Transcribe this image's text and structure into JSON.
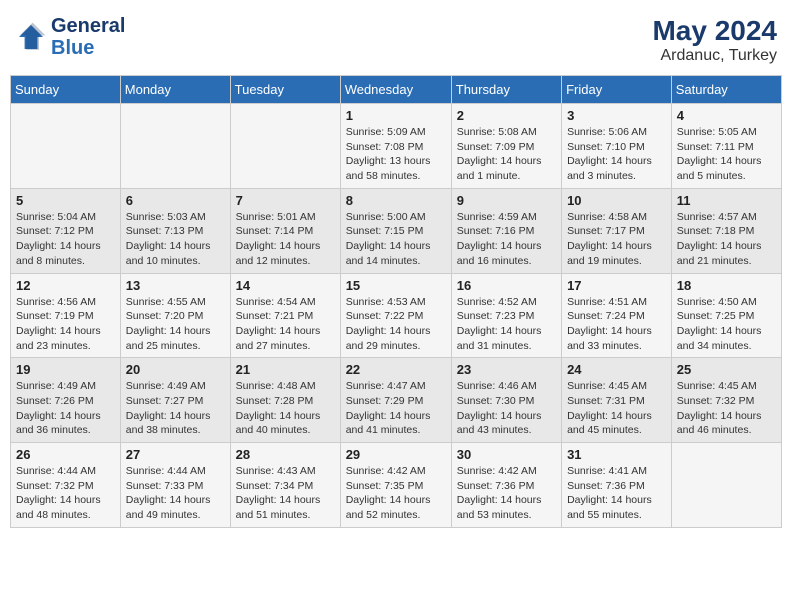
{
  "header": {
    "logo_line1": "General",
    "logo_line2": "Blue",
    "month": "May 2024",
    "location": "Ardanuc, Turkey"
  },
  "weekdays": [
    "Sunday",
    "Monday",
    "Tuesday",
    "Wednesday",
    "Thursday",
    "Friday",
    "Saturday"
  ],
  "weeks": [
    [
      {
        "day": "",
        "detail": ""
      },
      {
        "day": "",
        "detail": ""
      },
      {
        "day": "",
        "detail": ""
      },
      {
        "day": "1",
        "detail": "Sunrise: 5:09 AM\nSunset: 7:08 PM\nDaylight: 13 hours and 58 minutes."
      },
      {
        "day": "2",
        "detail": "Sunrise: 5:08 AM\nSunset: 7:09 PM\nDaylight: 14 hours and 1 minute."
      },
      {
        "day": "3",
        "detail": "Sunrise: 5:06 AM\nSunset: 7:10 PM\nDaylight: 14 hours and 3 minutes."
      },
      {
        "day": "4",
        "detail": "Sunrise: 5:05 AM\nSunset: 7:11 PM\nDaylight: 14 hours and 5 minutes."
      }
    ],
    [
      {
        "day": "5",
        "detail": "Sunrise: 5:04 AM\nSunset: 7:12 PM\nDaylight: 14 hours and 8 minutes."
      },
      {
        "day": "6",
        "detail": "Sunrise: 5:03 AM\nSunset: 7:13 PM\nDaylight: 14 hours and 10 minutes."
      },
      {
        "day": "7",
        "detail": "Sunrise: 5:01 AM\nSunset: 7:14 PM\nDaylight: 14 hours and 12 minutes."
      },
      {
        "day": "8",
        "detail": "Sunrise: 5:00 AM\nSunset: 7:15 PM\nDaylight: 14 hours and 14 minutes."
      },
      {
        "day": "9",
        "detail": "Sunrise: 4:59 AM\nSunset: 7:16 PM\nDaylight: 14 hours and 16 minutes."
      },
      {
        "day": "10",
        "detail": "Sunrise: 4:58 AM\nSunset: 7:17 PM\nDaylight: 14 hours and 19 minutes."
      },
      {
        "day": "11",
        "detail": "Sunrise: 4:57 AM\nSunset: 7:18 PM\nDaylight: 14 hours and 21 minutes."
      }
    ],
    [
      {
        "day": "12",
        "detail": "Sunrise: 4:56 AM\nSunset: 7:19 PM\nDaylight: 14 hours and 23 minutes."
      },
      {
        "day": "13",
        "detail": "Sunrise: 4:55 AM\nSunset: 7:20 PM\nDaylight: 14 hours and 25 minutes."
      },
      {
        "day": "14",
        "detail": "Sunrise: 4:54 AM\nSunset: 7:21 PM\nDaylight: 14 hours and 27 minutes."
      },
      {
        "day": "15",
        "detail": "Sunrise: 4:53 AM\nSunset: 7:22 PM\nDaylight: 14 hours and 29 minutes."
      },
      {
        "day": "16",
        "detail": "Sunrise: 4:52 AM\nSunset: 7:23 PM\nDaylight: 14 hours and 31 minutes."
      },
      {
        "day": "17",
        "detail": "Sunrise: 4:51 AM\nSunset: 7:24 PM\nDaylight: 14 hours and 33 minutes."
      },
      {
        "day": "18",
        "detail": "Sunrise: 4:50 AM\nSunset: 7:25 PM\nDaylight: 14 hours and 34 minutes."
      }
    ],
    [
      {
        "day": "19",
        "detail": "Sunrise: 4:49 AM\nSunset: 7:26 PM\nDaylight: 14 hours and 36 minutes."
      },
      {
        "day": "20",
        "detail": "Sunrise: 4:49 AM\nSunset: 7:27 PM\nDaylight: 14 hours and 38 minutes."
      },
      {
        "day": "21",
        "detail": "Sunrise: 4:48 AM\nSunset: 7:28 PM\nDaylight: 14 hours and 40 minutes."
      },
      {
        "day": "22",
        "detail": "Sunrise: 4:47 AM\nSunset: 7:29 PM\nDaylight: 14 hours and 41 minutes."
      },
      {
        "day": "23",
        "detail": "Sunrise: 4:46 AM\nSunset: 7:30 PM\nDaylight: 14 hours and 43 minutes."
      },
      {
        "day": "24",
        "detail": "Sunrise: 4:45 AM\nSunset: 7:31 PM\nDaylight: 14 hours and 45 minutes."
      },
      {
        "day": "25",
        "detail": "Sunrise: 4:45 AM\nSunset: 7:32 PM\nDaylight: 14 hours and 46 minutes."
      }
    ],
    [
      {
        "day": "26",
        "detail": "Sunrise: 4:44 AM\nSunset: 7:32 PM\nDaylight: 14 hours and 48 minutes."
      },
      {
        "day": "27",
        "detail": "Sunrise: 4:44 AM\nSunset: 7:33 PM\nDaylight: 14 hours and 49 minutes."
      },
      {
        "day": "28",
        "detail": "Sunrise: 4:43 AM\nSunset: 7:34 PM\nDaylight: 14 hours and 51 minutes."
      },
      {
        "day": "29",
        "detail": "Sunrise: 4:42 AM\nSunset: 7:35 PM\nDaylight: 14 hours and 52 minutes."
      },
      {
        "day": "30",
        "detail": "Sunrise: 4:42 AM\nSunset: 7:36 PM\nDaylight: 14 hours and 53 minutes."
      },
      {
        "day": "31",
        "detail": "Sunrise: 4:41 AM\nSunset: 7:36 PM\nDaylight: 14 hours and 55 minutes."
      },
      {
        "day": "",
        "detail": ""
      }
    ]
  ]
}
